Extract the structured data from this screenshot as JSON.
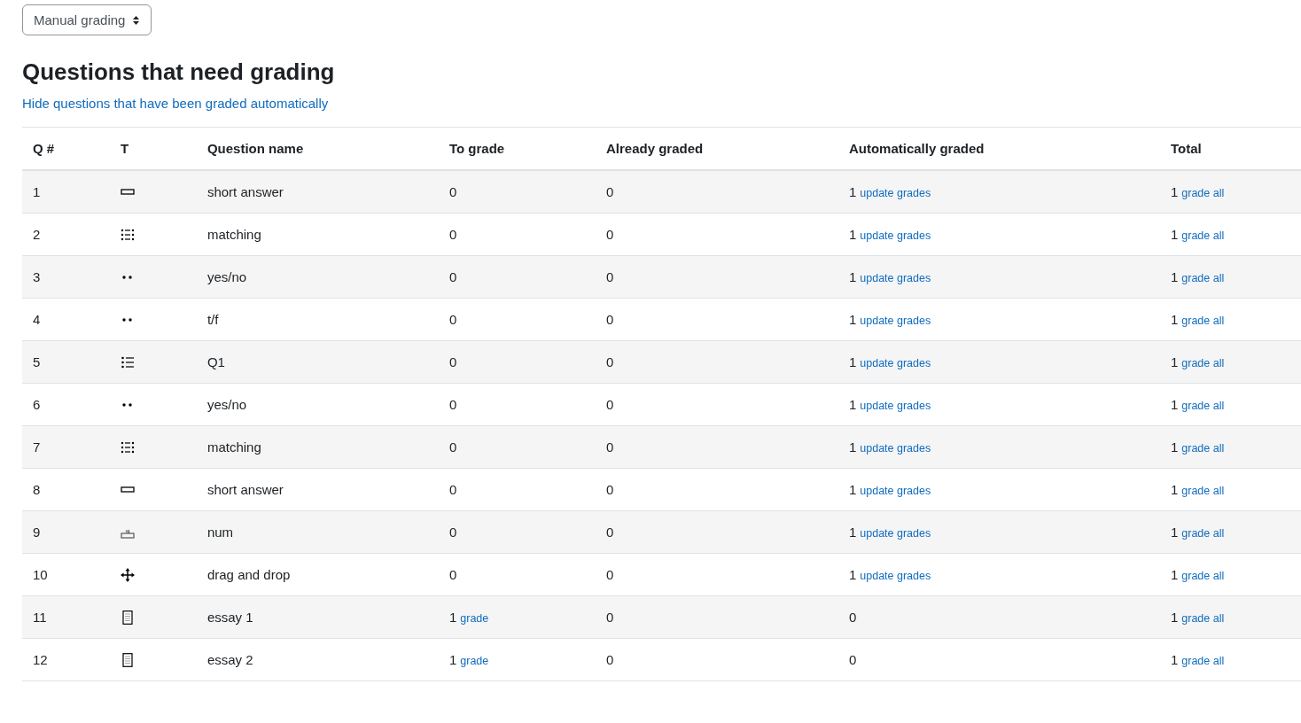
{
  "mode_select": {
    "value": "Manual grading"
  },
  "heading": "Questions that need grading",
  "toggle_link": "Hide questions that have been graded automatically",
  "table": {
    "columns": [
      "Q #",
      "T",
      "Question name",
      "To grade",
      "Already graded",
      "Automatically graded",
      "Total"
    ],
    "rows": [
      {
        "num": "1",
        "kind": "shortanswer",
        "name": "short answer",
        "to_grade": {
          "count": "0"
        },
        "already": "0",
        "auto": {
          "count": "1",
          "link": "update grades"
        },
        "total": {
          "count": "1",
          "link": "grade all"
        }
      },
      {
        "num": "2",
        "kind": "match",
        "name": "matching",
        "to_grade": {
          "count": "0"
        },
        "already": "0",
        "auto": {
          "count": "1",
          "link": "update grades"
        },
        "total": {
          "count": "1",
          "link": "grade all"
        }
      },
      {
        "num": "3",
        "kind": "truefalse",
        "name": "yes/no",
        "to_grade": {
          "count": "0"
        },
        "already": "0",
        "auto": {
          "count": "1",
          "link": "update grades"
        },
        "total": {
          "count": "1",
          "link": "grade all"
        }
      },
      {
        "num": "4",
        "kind": "truefalse",
        "name": "t/f",
        "to_grade": {
          "count": "0"
        },
        "already": "0",
        "auto": {
          "count": "1",
          "link": "update grades"
        },
        "total": {
          "count": "1",
          "link": "grade all"
        }
      },
      {
        "num": "5",
        "kind": "multichoice",
        "name": "Q1",
        "to_grade": {
          "count": "0"
        },
        "already": "0",
        "auto": {
          "count": "1",
          "link": "update grades"
        },
        "total": {
          "count": "1",
          "link": "grade all"
        }
      },
      {
        "num": "6",
        "kind": "truefalse",
        "name": "yes/no",
        "to_grade": {
          "count": "0"
        },
        "already": "0",
        "auto": {
          "count": "1",
          "link": "update grades"
        },
        "total": {
          "count": "1",
          "link": "grade all"
        }
      },
      {
        "num": "7",
        "kind": "match",
        "name": "matching",
        "to_grade": {
          "count": "0"
        },
        "already": "0",
        "auto": {
          "count": "1",
          "link": "update grades"
        },
        "total": {
          "count": "1",
          "link": "grade all"
        }
      },
      {
        "num": "8",
        "kind": "shortanswer",
        "name": "short answer",
        "to_grade": {
          "count": "0"
        },
        "already": "0",
        "auto": {
          "count": "1",
          "link": "update grades"
        },
        "total": {
          "count": "1",
          "link": "grade all"
        }
      },
      {
        "num": "9",
        "kind": "numerical",
        "name": "num",
        "to_grade": {
          "count": "0"
        },
        "already": "0",
        "auto": {
          "count": "1",
          "link": "update grades"
        },
        "total": {
          "count": "1",
          "link": "grade all"
        }
      },
      {
        "num": "10",
        "kind": "ddwtos",
        "name": "drag and drop",
        "to_grade": {
          "count": "0"
        },
        "already": "0",
        "auto": {
          "count": "1",
          "link": "update grades"
        },
        "total": {
          "count": "1",
          "link": "grade all"
        }
      },
      {
        "num": "11",
        "kind": "essay",
        "name": "essay 1",
        "to_grade": {
          "count": "1",
          "link": "grade"
        },
        "already": "0",
        "auto": {
          "count": "0"
        },
        "total": {
          "count": "1",
          "link": "grade all"
        }
      },
      {
        "num": "12",
        "kind": "essay",
        "name": "essay 2",
        "to_grade": {
          "count": "1",
          "link": "grade"
        },
        "already": "0",
        "auto": {
          "count": "0"
        },
        "total": {
          "count": "1",
          "link": "grade all"
        }
      }
    ]
  }
}
